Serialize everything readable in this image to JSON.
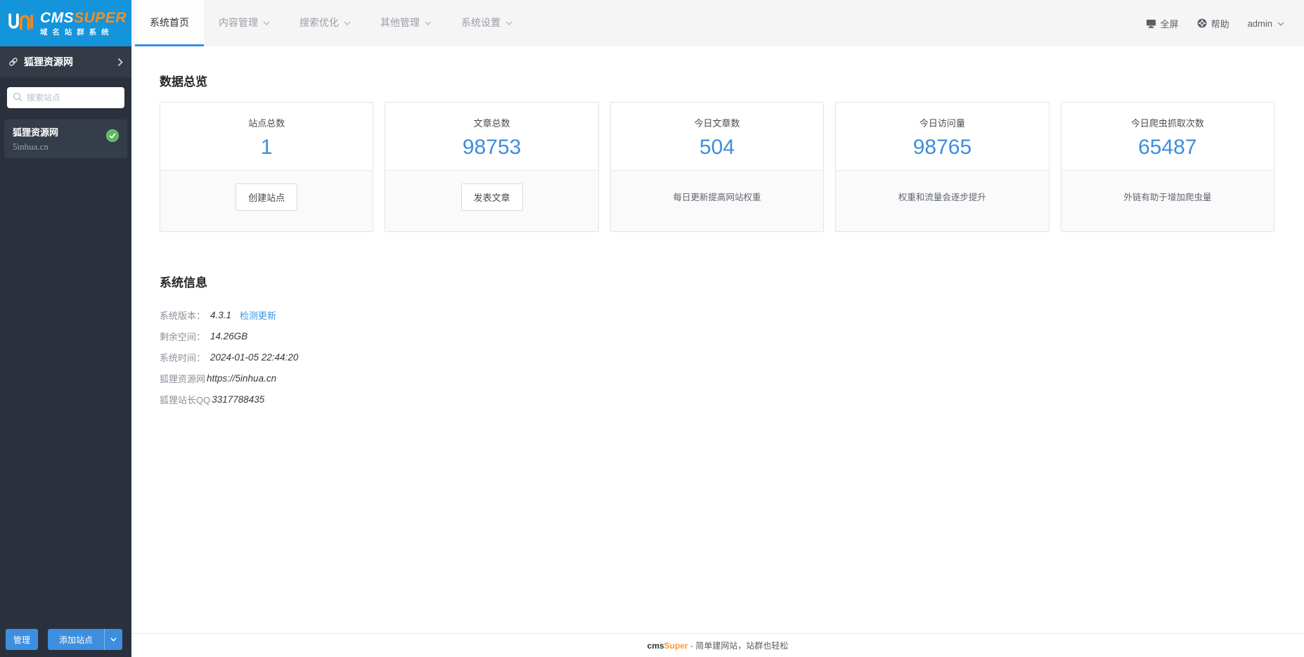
{
  "logo": {
    "title_cms": "CMS",
    "title_super": "SUPER",
    "subtitle": "域 名 站 群 系 统"
  },
  "header": {
    "tabs": [
      {
        "label": "系统首页",
        "active": true
      },
      {
        "label": "内容管理",
        "active": false
      },
      {
        "label": "搜索优化",
        "active": false
      },
      {
        "label": "其他管理",
        "active": false
      },
      {
        "label": "系统设置",
        "active": false
      }
    ],
    "fullscreen_label": "全屏",
    "help_label": "帮助",
    "username": "admin"
  },
  "sidebar": {
    "current_site": "狐狸资源网",
    "search_placeholder": "搜索站点",
    "sites": [
      {
        "name": "狐狸资源网",
        "domain": "5inhua.cn",
        "status": "active"
      }
    ],
    "manage_label": "管理",
    "add_site_label": "添加站点"
  },
  "overview": {
    "title": "数据总览",
    "cards": [
      {
        "label": "站点总数",
        "value": "1",
        "action": "创建站点"
      },
      {
        "label": "文章总数",
        "value": "98753",
        "action": "发表文章"
      },
      {
        "label": "今日文章数",
        "value": "504",
        "note": "每日更新提高网站权重"
      },
      {
        "label": "今日访问量",
        "value": "98765",
        "note": "权重和流量会逐步提升"
      },
      {
        "label": "今日爬虫抓取次数",
        "value": "65487",
        "note": "外链有助于增加爬虫量"
      }
    ]
  },
  "system_info": {
    "title": "系统信息",
    "rows": [
      {
        "label": "系统版本：",
        "value": "4.3.1",
        "link": "检测更新"
      },
      {
        "label": "剩余空间：",
        "value": "14.26GB"
      },
      {
        "label": "系统时间：",
        "value": "2024-01-05 22:44:20"
      },
      {
        "label": "狐狸资源网",
        "value": "https://5inhua.cn"
      },
      {
        "label": "狐狸站长QQ",
        "value": "3317788435"
      }
    ]
  },
  "footer": {
    "brand_cms": "cms",
    "brand_super": "Super",
    "tagline": " - 简单建网站，站群也轻松"
  },
  "colors": {
    "brand_blue": "#1494db",
    "brand_orange": "#ff8d1a",
    "accent_blue": "#3e8ede",
    "number_blue": "#3e8ddd",
    "success_green": "#5cb85c",
    "sidebar_dark": "#2b313c"
  }
}
